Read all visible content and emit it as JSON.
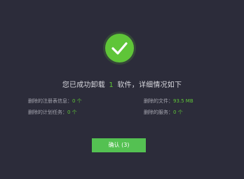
{
  "headline": {
    "prefix": "您已成功卸载",
    "count": "1",
    "suffix": "软件，详细情况如下"
  },
  "details": {
    "registry": {
      "label": "删除的注册表信息：",
      "value": "0 个"
    },
    "tasks": {
      "label": "删除的计划任务：",
      "value": "0 个"
    },
    "files": {
      "label": "删除的文件：",
      "value": "93.5 MB"
    },
    "services": {
      "label": "删除的服务：",
      "value": "0 个"
    }
  },
  "confirm_button": {
    "label": "确认 (3)"
  },
  "colors": {
    "background": "#2c2c3a",
    "accent": "#5fc538",
    "button": "#54c152"
  },
  "icons": {
    "status": "check-circle-icon"
  }
}
